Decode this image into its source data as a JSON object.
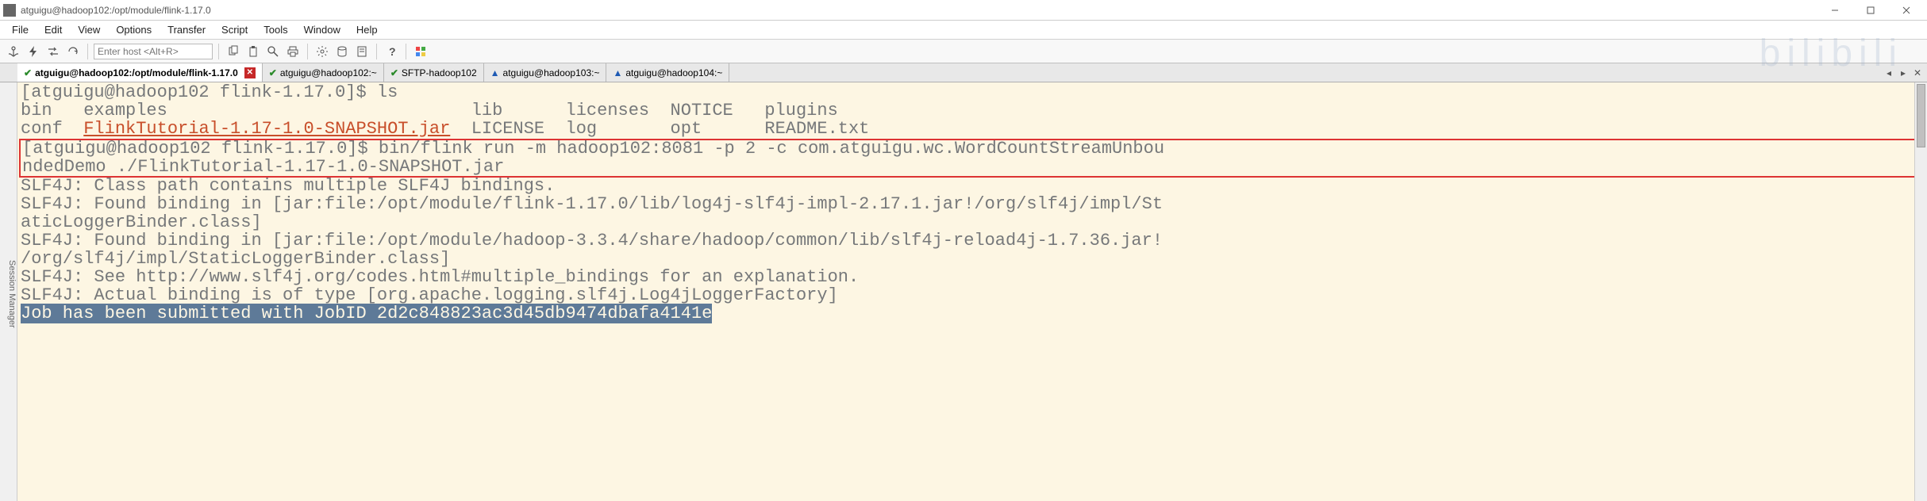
{
  "window": {
    "title": "atguigu@hadoop102:/opt/module/flink-1.17.0"
  },
  "menu": {
    "items": [
      "File",
      "Edit",
      "View",
      "Options",
      "Transfer",
      "Script",
      "Tools",
      "Window",
      "Help"
    ]
  },
  "toolbar": {
    "host_placeholder": "Enter host <Alt+R>",
    "icons": [
      "anchor",
      "bolt",
      "swap",
      "reload",
      "copy",
      "paste",
      "find",
      "print",
      "gear",
      "db",
      "props",
      "help",
      "palette"
    ]
  },
  "tabs": [
    {
      "status": "ok",
      "label": "atguigu@hadoop102:/opt/module/flink-1.17.0",
      "active": true,
      "closeable": true
    },
    {
      "status": "ok",
      "label": "atguigu@hadoop102:~"
    },
    {
      "status": "ok",
      "label": "SFTP-hadoop102"
    },
    {
      "status": "warn",
      "label": "atguigu@hadoop103:~"
    },
    {
      "status": "warn",
      "label": "atguigu@hadoop104:~"
    }
  ],
  "sidebar": {
    "label": "Session Manager"
  },
  "terminal": {
    "prompt1": "[atguigu@hadoop102 flink-1.17.0]$ ",
    "cmd1": "ls",
    "ls_row1": "bin   examples                             lib      licenses  NOTICE   plugins",
    "ls_row2a": "conf  ",
    "ls_jar": "FlinkTutorial-1.17-1.0-SNAPSHOT.jar",
    "ls_row2b": "  LICENSE  log       opt      README.txt",
    "box_line1a": "[atguigu@hadoop102 flink-1.17.0]$ ",
    "box_line1b": "bin/flink run -m hadoop102:8081 -p 2 -c com.atguigu.wc.WordCountStreamUnbou",
    "box_line2": "ndedDemo ./FlinkTutorial-1.17-1.0-SNAPSHOT.jar",
    "out1": "SLF4J: Class path contains multiple SLF4J bindings.",
    "out2": "SLF4J: Found binding in [jar:file:/opt/module/flink-1.17.0/lib/log4j-slf4j-impl-2.17.1.jar!/org/slf4j/impl/St",
    "out3": "aticLoggerBinder.class]",
    "out4": "SLF4J: Found binding in [jar:file:/opt/module/hadoop-3.3.4/share/hadoop/common/lib/slf4j-reload4j-1.7.36.jar!",
    "out5": "/org/slf4j/impl/StaticLoggerBinder.class]",
    "out6": "SLF4J: See http://www.slf4j.org/codes.html#multiple_bindings for an explanation.",
    "out7": "SLF4J: Actual binding is of type [org.apache.logging.slf4j.Log4jLoggerFactory]",
    "out8": "Job has been submitted with JobID 2d2c848823ac3d45db9474dbafa4141e"
  },
  "watermark": "bilibili"
}
